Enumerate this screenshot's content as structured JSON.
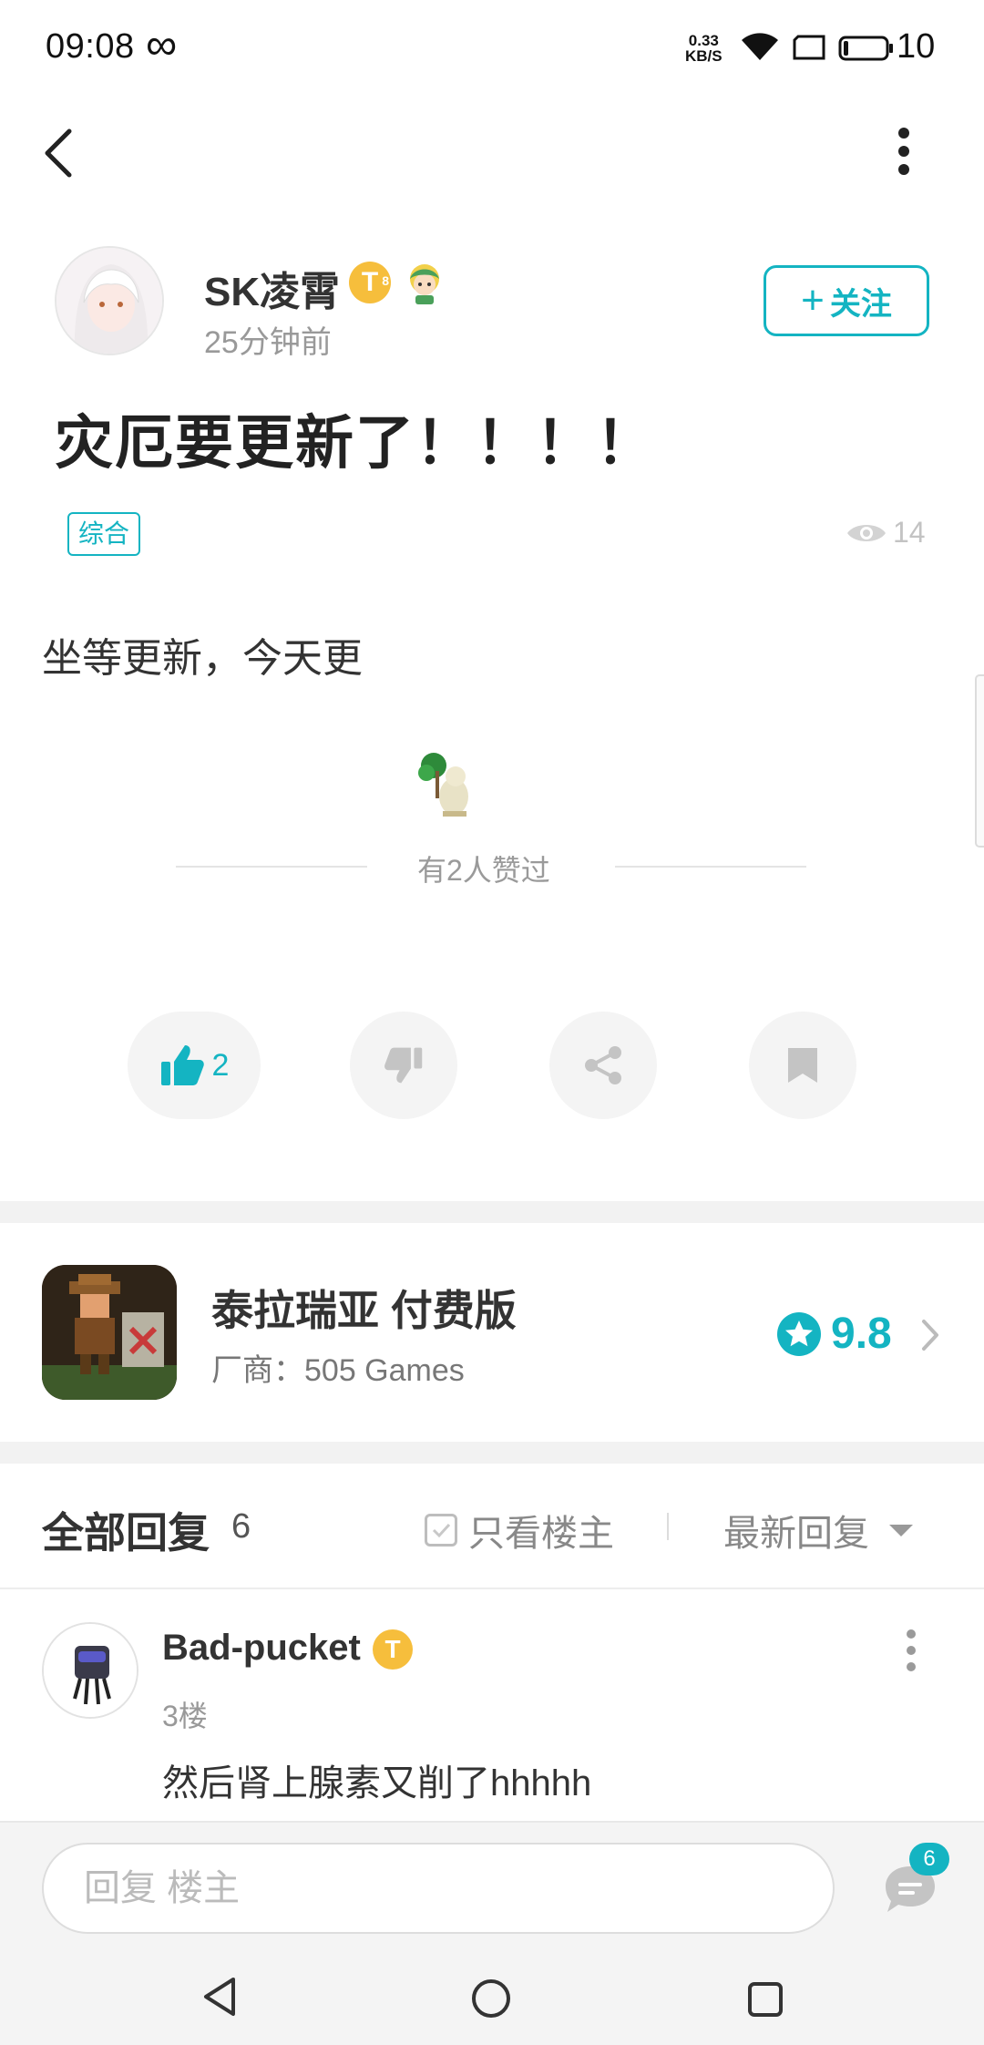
{
  "status_bar": {
    "time": "09:08",
    "net_speed_value": "0.33",
    "net_speed_unit": "KB/S",
    "battery": "10"
  },
  "post": {
    "author": "SK凌霄",
    "author_badge": "T",
    "time_ago": "25分钟前",
    "follow_label": "关注",
    "title": "灾厄要更新了！！！！",
    "tag": "综合",
    "views": "14",
    "body": "坐等更新，今天更",
    "liked_text": "有2人赞过",
    "like_count": "2"
  },
  "game": {
    "name": "泰拉瑞亚 付费版",
    "vendor": "厂商：505 Games",
    "rating": "9.8"
  },
  "replies": {
    "title": "全部回复",
    "count": "6",
    "only_author": "只看楼主",
    "sort": "最新回复",
    "items": [
      {
        "author": "Bad-pucket",
        "badge": "T",
        "floor": "3楼",
        "text": "然后肾上腺素又削了hhhhh"
      }
    ]
  },
  "bottom": {
    "reply_placeholder": "回复  楼主",
    "message_badge": "6"
  },
  "colors": {
    "accent": "#14b4c2",
    "badge_gold": "#f6be3c"
  }
}
